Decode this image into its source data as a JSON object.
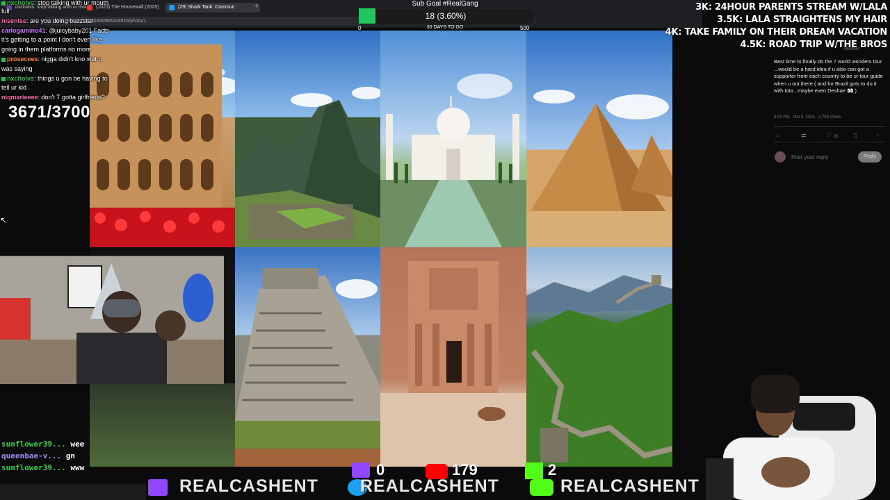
{
  "browser": {
    "tabs": [
      {
        "label": "nxcholvs: stop talking with ur mouth",
        "color": "#6441a5"
      },
      {
        "label": "(1023) The Housewall (2025)",
        "color": "#e53935"
      },
      {
        "label": "(29) Shark Tank: Commun",
        "color": "#1d9bf0"
      }
    ],
    "url": "x.com/.../status/1975034056524391​6/photo/1"
  },
  "chat": {
    "top_message": {
      "user": "nxcholvs",
      "text": "stop talking with ur mouth"
    },
    "messages": [
      {
        "user": "",
        "text": "full",
        "color": "#ffffff"
      },
      {
        "user": "nisenise",
        "text": "are you doing buzzstar",
        "color": "#ff6fb0"
      },
      {
        "user": "carlogamino41",
        "text": "@juicybaby201 Facts",
        "color": "#c77dff"
      },
      {
        "user": "",
        "text": "it's getting to a point I don't even like",
        "color": "#ffffff"
      },
      {
        "user": "",
        "text": "going in them platforms no more",
        "color": "#ffffff"
      },
      {
        "user": "prosecees",
        "text": "nigga didn't kno wat u",
        "color": "#ff8a3d"
      },
      {
        "user": "",
        "text": "was saying",
        "color": "#ffffff"
      },
      {
        "user": "nxcholvs",
        "text": "things u gon be having to",
        "color": "#2fbf4f"
      },
      {
        "user": "",
        "text": "tell ur kid",
        "color": "#ffffff"
      },
      {
        "user": "niqmarieeee",
        "text": "don't T gotta girlfriend?",
        "color": "#ff6fb0"
      }
    ],
    "counter": "3671/3700",
    "bottom": [
      {
        "user": "sunflower39...",
        "text": "wee",
        "color": "#39d353"
      },
      {
        "user": "queenbae-v...",
        "text": "gn",
        "color": "#a78bfa"
      },
      {
        "user": "sunflower39...",
        "text": "www",
        "color": "#39d353"
      }
    ]
  },
  "sub_goal": {
    "title": "Sub Goal #RealGang",
    "progress_text": "18 (3.60%)",
    "progress_fraction": 0.036,
    "start": "0",
    "middle": "30 DAYS TO GO",
    "end": "500",
    "color": "#22c55e"
  },
  "goals": [
    "3K: 24HOUR PARENTS STREAM W/LALA",
    "3.5K: LALA STRAIGHTENS MY HAIR",
    "4K: TAKE FAMILY ON THEIR DREAM VACATION",
    "4.5K: ROAD TRIP W/THE BROS"
  ],
  "tweet": {
    "badge": "Member",
    "text": "Best time to finally do the 7 world wonders tour ...would be a hard idea if u also can got a supporter from each country to be ur tour guide when u out there ( and for Brazil gots to do it with tota , maybe even Deshae 👀 )",
    "meta": "8:00 PM · Oct 5, 2025 · 2,793 Views",
    "actions": [
      "",
      "",
      "29",
      "",
      ""
    ],
    "reply_placeholder": "Post your reply",
    "reply_button": "Reply"
  },
  "stats": {
    "twitch": "0",
    "youtube": "179",
    "kick": "2"
  },
  "handles": [
    "REALCASHENT",
    "REALCASHENT",
    "REALCASHENT"
  ]
}
